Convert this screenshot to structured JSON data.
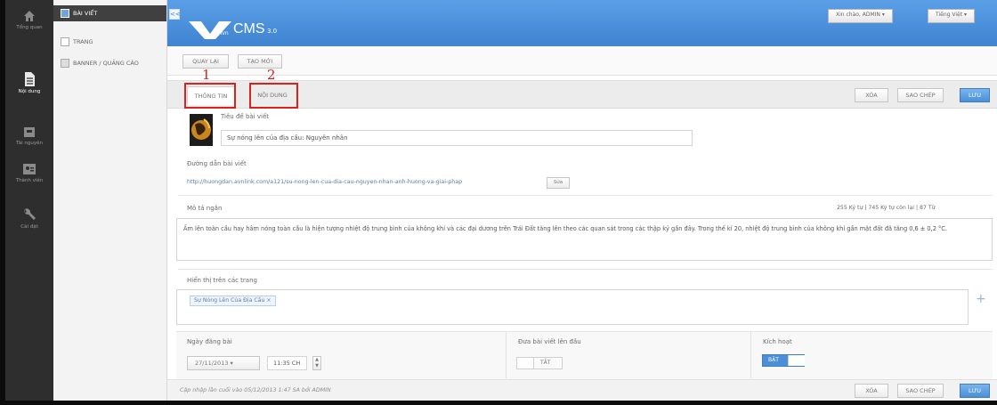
{
  "rail": {
    "items": [
      {
        "label": "Tổng quan",
        "icon": "home-icon"
      },
      {
        "label": "Nội dung",
        "icon": "document-icon"
      },
      {
        "label": "Tài nguyên",
        "icon": "box-icon"
      },
      {
        "label": "Thành viên",
        "icon": "users-icon"
      },
      {
        "label": "Cài đặt",
        "icon": "wrench-icon"
      }
    ]
  },
  "sidebar": {
    "items": [
      {
        "label": "BÀI VIẾT",
        "icon": "article-icon"
      },
      {
        "label": "TRANG",
        "icon": "page-icon"
      },
      {
        "label": "BANNER / QUẢNG CÁO",
        "icon": "banner-icon"
      }
    ]
  },
  "header": {
    "collapse": "<<",
    "logo_small": "vnvn",
    "logo_text": "CMS",
    "logo_version": "3.0",
    "greeting": "Xin chào, ADMIN",
    "language": "Tiếng Việt",
    "accent": "#4a8fd8"
  },
  "toolbar": {
    "back": "QUAY LẠI",
    "new": "TẠO MỚI"
  },
  "tabs": {
    "info": "THÔNG TIN",
    "content": "NỘI DUNG",
    "marker1": "1",
    "marker2": "2",
    "marker_color": "#d9221e"
  },
  "actions": {
    "delete": "XÓA",
    "copy": "SAO CHÉP",
    "save": "LƯU"
  },
  "form": {
    "title_label": "Tiêu đề bài viết",
    "title_value": "Sự nóng lên của địa cầu: Nguyên nhân",
    "url_label": "Đường dẫn bài viết",
    "url_value": "http://huongdan.avnlink.com/a121/su-nong-len-cua-dia-cau-nguyen-nhan-anh-huong-va-giai-phap",
    "url_edit": "Sửa",
    "desc_label": "Mô tả ngắn",
    "desc_counter": "255 Ký tự | 745 Ký tự còn lại | 87 Từ",
    "desc_value": "Ấm lên toàn cầu hay hâm nóng toàn cầu là hiện tượng nhiệt độ trung bình của không khí và các đại dương trên Trái Đất tăng lên theo các quan sát trong các thập kỷ gần đây. Trong thế kỉ 20, nhiệt độ trung bình của không khí gần mặt đất đã tăng 0,6 ± 0,2 °C.",
    "tags_label": "Hiển thị trên các trang",
    "tag": "Sự Nóng Lên Của Địa Cầu ×",
    "add": "+",
    "date_label": "Ngày đăng bài",
    "date_value": "27/11/2013",
    "time_value": "11:35 CH",
    "top_label": "Đưa bài viết lên đầu",
    "top_toggle": "TẮT",
    "active_label": "Kích hoạt",
    "active_toggle": "BẬT"
  },
  "footer": {
    "note": "Cập nhập lần cuối vào 05/12/2013 1:47 SA bởi ADMIN"
  }
}
